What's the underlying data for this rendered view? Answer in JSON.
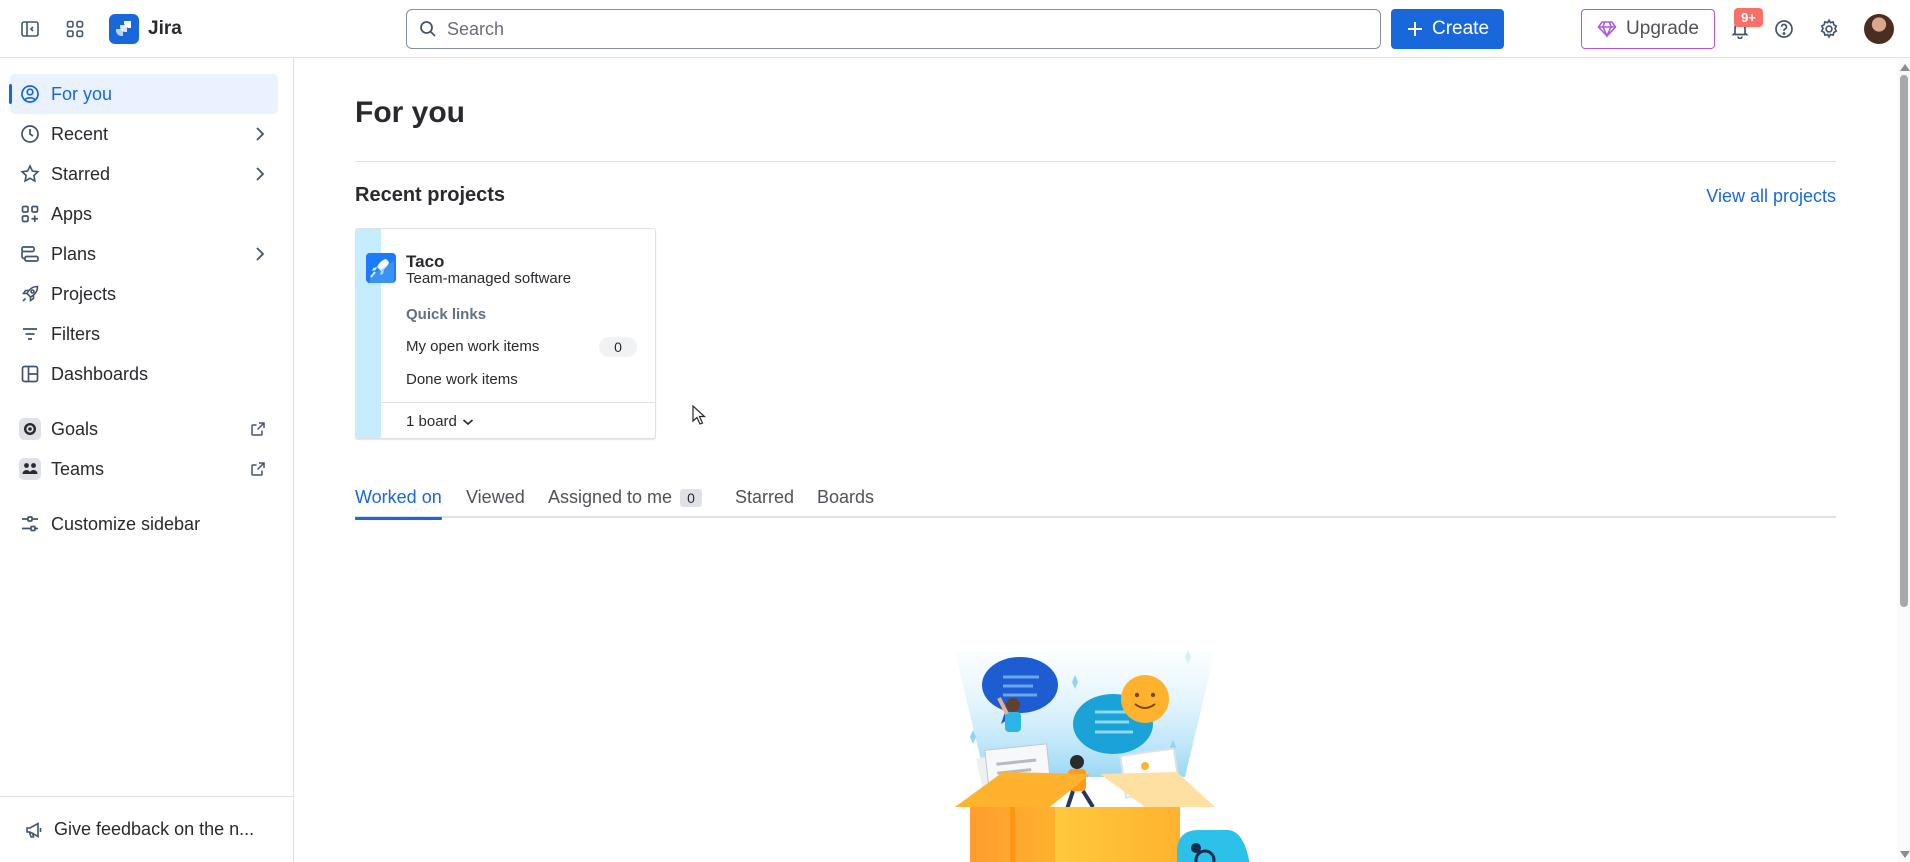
{
  "app": {
    "name": "Jira"
  },
  "topbar": {
    "search_placeholder": "Search",
    "create_label": "Create",
    "upgrade_label": "Upgrade",
    "notifications_badge": "9+"
  },
  "sidebar": {
    "items": [
      {
        "label": "For you",
        "icon": "person-circle-icon",
        "active": true
      },
      {
        "label": "Recent",
        "icon": "clock-icon",
        "chevron": true
      },
      {
        "label": "Starred",
        "icon": "star-icon",
        "chevron": true
      },
      {
        "label": "Apps",
        "icon": "apps-add-icon"
      },
      {
        "label": "Plans",
        "icon": "plans-icon",
        "chevron": true
      },
      {
        "label": "Projects",
        "icon": "rocket-icon"
      },
      {
        "label": "Filters",
        "icon": "filter-icon"
      },
      {
        "label": "Dashboards",
        "icon": "dashboard-icon"
      },
      {
        "label": "Goals",
        "icon": "goals-icon",
        "external": true
      },
      {
        "label": "Teams",
        "icon": "teams-icon",
        "external": true
      },
      {
        "label": "Customize sidebar",
        "icon": "customize-icon"
      }
    ],
    "feedback_label": "Give feedback on the n..."
  },
  "main": {
    "title": "For you",
    "recent_projects": {
      "title": "Recent projects",
      "view_all_label": "View all projects",
      "projects": [
        {
          "name": "Taco",
          "type": "Team-managed software",
          "quick_links_label": "Quick links",
          "link_open": "My open work items",
          "link_open_count": "0",
          "link_done": "Done work items",
          "boards_label": "1 board"
        }
      ]
    },
    "tabs": [
      {
        "label": "Worked on",
        "active": true
      },
      {
        "label": "Viewed"
      },
      {
        "label": "Assigned to me",
        "count": "0"
      },
      {
        "label": "Starred"
      },
      {
        "label": "Boards"
      }
    ]
  },
  "colors": {
    "brand": "#1868db",
    "upgrade_border": "#af59e1",
    "badge": "#f87168",
    "active_bg": "#e9f2fe",
    "card_stripe": "#c6edfb"
  }
}
